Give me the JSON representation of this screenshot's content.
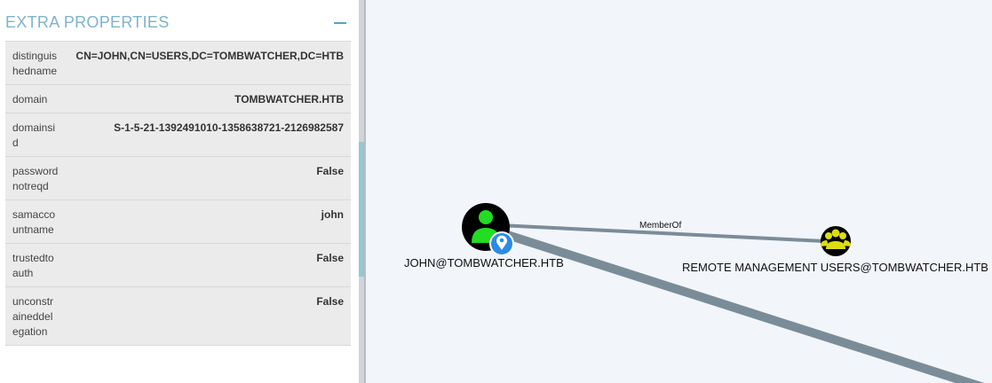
{
  "panel": {
    "title": "EXTRA PROPERTIES",
    "properties": [
      {
        "key": "distinguishedname",
        "value": "CN=JOHN,CN=USERS,DC=TOMBWATCHER,DC=HTB"
      },
      {
        "key": "domain",
        "value": "TOMBWATCHER.HTB"
      },
      {
        "key": "domainsid",
        "value": "S-1-5-21-1392491010-1358638721-2126982587"
      },
      {
        "key": "passwordnotreqd",
        "value": "False"
      },
      {
        "key": "samaccountname",
        "value": "john"
      },
      {
        "key": "trustedtoauth",
        "value": "False"
      },
      {
        "key": "unconstraineddelegation",
        "value": "False"
      }
    ]
  },
  "graph": {
    "nodes": {
      "user": {
        "label": "JOHN@TOMBWATCHER.HTB",
        "icon": "user-icon",
        "badge": "location-pin-icon"
      },
      "group": {
        "label": "REMOTE MANAGEMENT USERS@TOMBWATCHER.HTB",
        "icon": "group-icon"
      }
    },
    "edges": {
      "memberof": {
        "label": "MemberOf"
      }
    }
  },
  "colors": {
    "header_text": "#7fb3cc",
    "row_bg": "#ebebeb",
    "canvas_bg": "#f2f5fa",
    "edge": "#7b8c99",
    "user_icon": "#22dd22",
    "group_icon": "#dddd11",
    "badge": "#2a8be6"
  }
}
